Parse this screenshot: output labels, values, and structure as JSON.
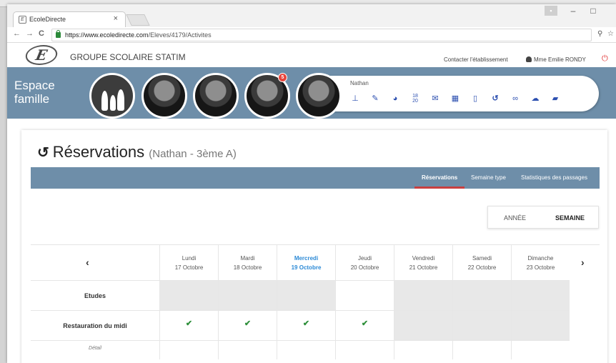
{
  "browser": {
    "tab_title": "EcoleDirecte",
    "favicon": "E",
    "tab_close": "×",
    "url_host": "https://www.ecoledirecte.com",
    "url_path": "/Eleves/4179/Activites",
    "window_buttons": [
      "▪",
      "–",
      "□"
    ],
    "nav": {
      "back": "←",
      "forward": "→",
      "reload": "C"
    },
    "addr_right": [
      "⚲",
      "☆"
    ]
  },
  "header": {
    "logo_letter": "E",
    "org_name": "GROUPE SCOLAIRE STATIM",
    "contact_link": "Contacter l'établissement",
    "user_name": "Mme Emilie RONDY",
    "logout_icon": "power-icon"
  },
  "band": {
    "title_line1": "Espace",
    "title_line2": "famille",
    "child_name": "Nathan",
    "notification_count": "5",
    "menu_icons": [
      "ruler-icon",
      "pin-icon",
      "chat-icon",
      "grades-icon",
      "mail-icon",
      "calendar-icon",
      "document-icon",
      "reservation-icon",
      "link-icon",
      "cloud-icon",
      "book-icon"
    ],
    "accent_color": "#6e8ea9",
    "icon_color": "#2c4fb0"
  },
  "page": {
    "title": "Réservations",
    "subtitle": "(Nathan - 3ème A)",
    "tabs": [
      "Réservations",
      "Semaine type",
      "Statistiques des passages"
    ],
    "active_tab": "Réservations",
    "view_toggle": {
      "year": "ANNÉE",
      "week": "SEMAINE",
      "selected": "SEMAINE"
    }
  },
  "calendar": {
    "prev": "‹",
    "next": "›",
    "days": [
      {
        "name": "Lundi",
        "date": "17 Octobre"
      },
      {
        "name": "Mardi",
        "date": "18 Octobre"
      },
      {
        "name": "Mercredi",
        "date": "19 Octobre",
        "today": true
      },
      {
        "name": "Jeudi",
        "date": "20 Octobre"
      },
      {
        "name": "Vendredi",
        "date": "21 Octobre"
      },
      {
        "name": "Samedi",
        "date": "22 Octobre"
      },
      {
        "name": "Dimanche",
        "date": "23 Octobre"
      }
    ],
    "rows": [
      {
        "label": "Etudes",
        "cells": [
          "grey",
          "grey",
          "grey",
          "white",
          "grey",
          "grey",
          "grey"
        ]
      },
      {
        "label": "Restauration du midi",
        "cells": [
          "check",
          "check",
          "check",
          "check",
          "grey",
          "grey",
          "grey"
        ]
      }
    ],
    "detail_label": "Détail",
    "check_glyph": "✔",
    "check_color": "#2e8f3a",
    "today_color": "#2c8ad6"
  }
}
